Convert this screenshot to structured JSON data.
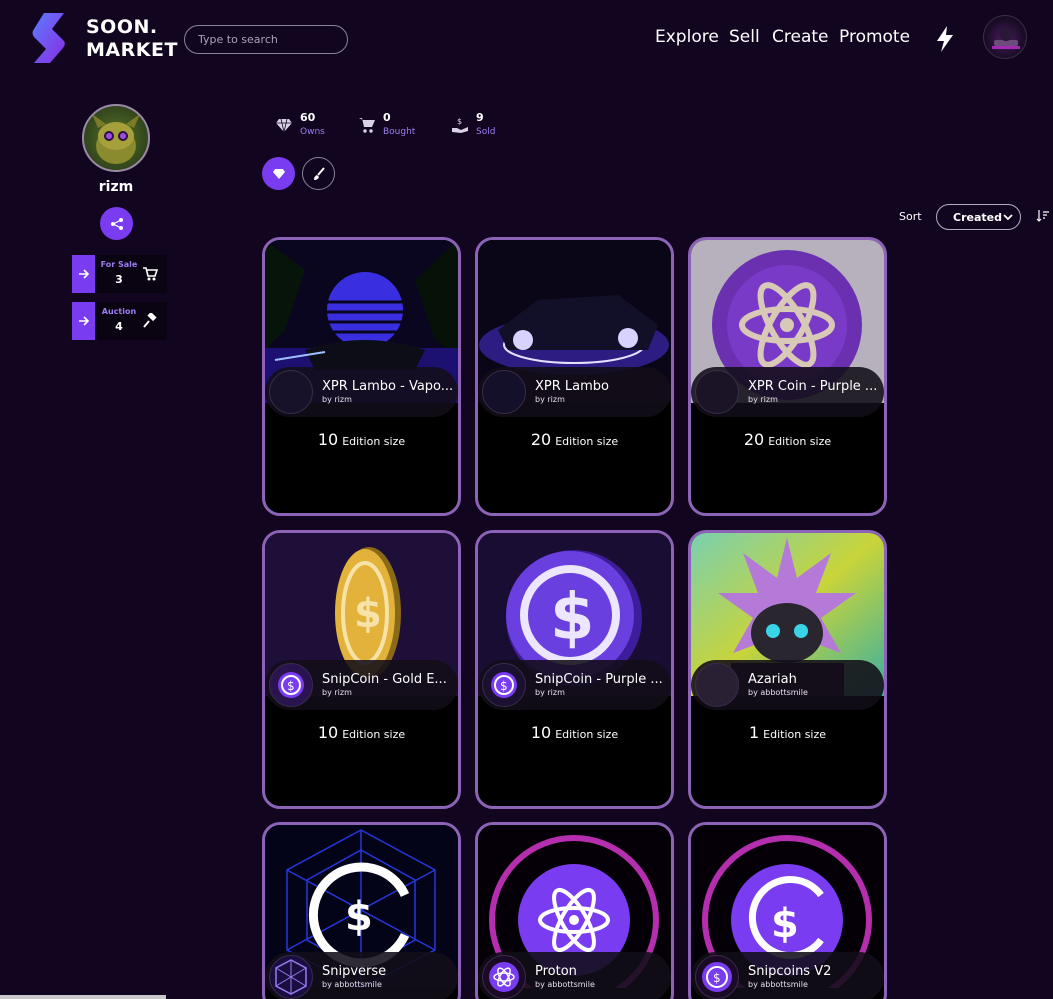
{
  "header": {
    "logo_line1": "SOON.",
    "logo_line2": "MARKET",
    "search_placeholder": "Type to search",
    "nav": [
      "Explore",
      "Sell",
      "Create",
      "Promote"
    ]
  },
  "profile": {
    "username": "rizm",
    "for_sale_label": "For Sale",
    "for_sale_count": "3",
    "auction_label": "Auction",
    "auction_count": "4"
  },
  "counts": [
    {
      "icon": "diamond-icon",
      "value": "60",
      "label": "Owns"
    },
    {
      "icon": "cart-icon",
      "value": "0",
      "label": "Bought"
    },
    {
      "icon": "dollar-hand-icon",
      "value": "9",
      "label": "Sold"
    }
  ],
  "sort": {
    "label": "Sort",
    "selected": "Created"
  },
  "colors": {
    "accent": "#7a3cf0",
    "background": "#12051f",
    "card_border": "#8d63b8"
  },
  "cards": [
    {
      "title": "XPR Lambo - Vapo...",
      "by": "by rizm",
      "edition_count": "10",
      "edition_label": "Edition size"
    },
    {
      "title": "XPR Lambo",
      "by": "by rizm",
      "edition_count": "20",
      "edition_label": "Edition size"
    },
    {
      "title": "XPR Coin - Purple ...",
      "by": "by rizm",
      "edition_count": "20",
      "edition_label": "Edition size"
    },
    {
      "title": "SnipCoin - Gold E...",
      "by": "by rizm",
      "edition_count": "10",
      "edition_label": "Edition size"
    },
    {
      "title": "SnipCoin - Purple ...",
      "by": "by rizm",
      "edition_count": "10",
      "edition_label": "Edition size"
    },
    {
      "title": "Azariah",
      "by": "by abbottsmile",
      "edition_count": "1",
      "edition_label": "Edition size"
    },
    {
      "title": "Snipverse",
      "by": "by abbottsmile",
      "edition_count": "",
      "edition_label": ""
    },
    {
      "title": "Proton",
      "by": "by abbottsmile",
      "edition_count": "",
      "edition_label": ""
    },
    {
      "title": "Snipcoins V2",
      "by": "by abbottsmile",
      "edition_count": "",
      "edition_label": ""
    }
  ]
}
